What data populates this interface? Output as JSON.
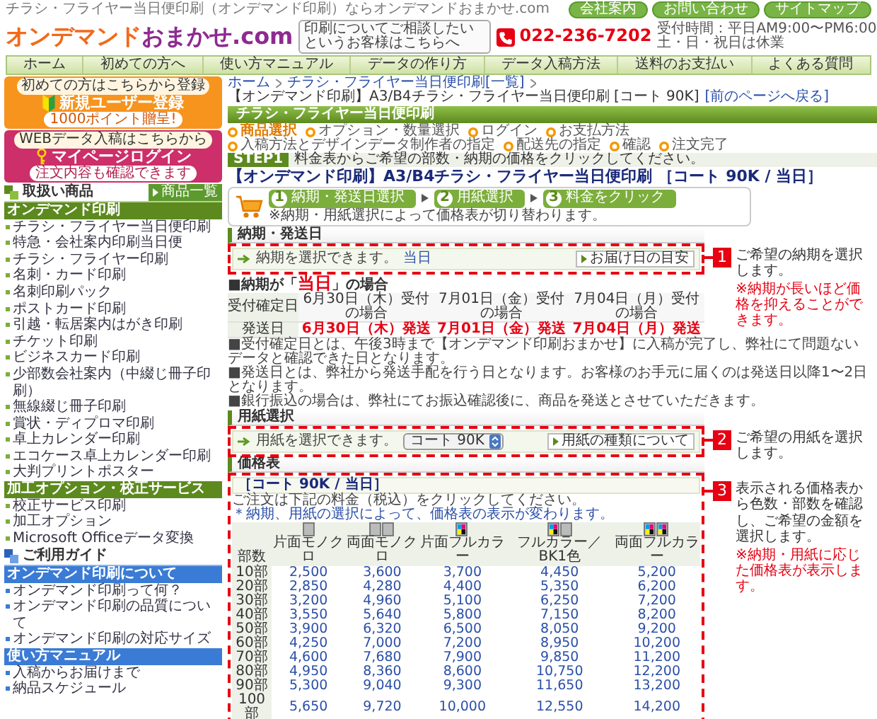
{
  "header": {
    "tagline": "チラシ・フライヤー当日便印刷（オンデマンド印刷）ならオンデマンドおまかせ.com",
    "links": [
      "会社案内",
      "お問い合わせ",
      "サイトマップ"
    ],
    "logo": {
      "part_1": "オンデマンド",
      "part_2": "おまかせ.com"
    },
    "consult_text": "印刷についてご相談したいというお客様はこちらへ",
    "phone": "022-236-7202",
    "hours": [
      "受付時間：平日AM9:00〜PM6:00",
      "土・日・祝日は休業"
    ],
    "nav": [
      "ホーム",
      "初めての方へ",
      "使い方マニュアル",
      "データの作り方",
      "データ入稿方法",
      "送料のお支払い",
      "よくある質問"
    ]
  },
  "sidebar": {
    "banners": [
      {
        "kind": "register",
        "lead": "初めての方はこちらから登録",
        "title": "新規ユーザー登録",
        "note": "1000ポイント贈呈!"
      },
      {
        "kind": "login",
        "lead": "WEBデータ入稿はこちらから",
        "title": "マイページログイン",
        "note": "注文内容も確認できます"
      }
    ],
    "products_title": "取扱い商品",
    "products_button": "商品一覧",
    "product_sections": [
      {
        "title": "オンデマンド印刷",
        "items": [
          "チラシ・フライヤー当日便印刷",
          "特急・会社案内印刷当日便",
          "チラシ・フライヤー印刷",
          "名刺・カード印刷",
          "名刺印刷パック",
          "ポストカード印刷",
          "引越・転居案内はがき印刷",
          "チケット印刷",
          "ビジネスカード印刷",
          "少部数会社案内（中綴じ冊子印刷）",
          "無線綴じ冊子印刷",
          "賞状・ディプロマ印刷",
          "卓上カレンダー印刷",
          "エコケース卓上カレンダー印刷",
          "大判プリントポスター"
        ]
      },
      {
        "title": "加工オプション・校正サービス",
        "items": [
          "校正サービス印刷",
          "加工オプション",
          "Microsoft Officeデータ変換"
        ]
      }
    ],
    "guide_title": "ご利用ガイド",
    "guide_sections": [
      {
        "title": "オンデマンド印刷について",
        "items": [
          "オンデマンド印刷って何？",
          "オンデマンド印刷の品質について",
          "オンデマンド印刷の対応サイズ"
        ]
      },
      {
        "title": "使い方マニュアル",
        "items": [
          "入稿からお届けまで",
          "納品スケジュール"
        ]
      }
    ]
  },
  "main": {
    "breadcrumb": [
      "ホーム",
      "チラシ・フライヤー当日便印刷[一覧]",
      "【オンデマンド印刷】A3/B4チラシ・フライヤー当日便印刷 [コート 90K]"
    ],
    "back_link": "[前のページへ戻る]",
    "section_bar": "チラシ・フライヤー当日便印刷",
    "order_steps": [
      {
        "label": "商品選択",
        "selected": true
      },
      {
        "label": "オプション・数量選択",
        "selected": false
      },
      {
        "label": "ログイン",
        "selected": false
      },
      {
        "label": "お支払方法",
        "selected": false
      },
      {
        "label": "入稿方法とデザインデータ制作者の指定",
        "selected": false
      },
      {
        "label": "配送先の指定",
        "selected": false
      },
      {
        "label": "確認",
        "selected": false
      },
      {
        "label": "注文完了",
        "selected": false
      }
    ],
    "step_badge": "STEP1",
    "step_text": "料金表からご希望の部数・納期の価格をクリックしてください。",
    "title_lines": [
      "【オンデマンド印刷】A3/B4チラシ・フライヤー当日便印刷",
      "［コート 90K / 当日］"
    ],
    "guide": {
      "steps": [
        {
          "number": "1",
          "label": "納期・発送日選択"
        },
        {
          "number": "2",
          "label": "用紙選択"
        },
        {
          "number": "3",
          "label": "料金をクリック"
        }
      ],
      "note": "※納期・用紙選択によって価格表が切り替わります。"
    },
    "delivery": {
      "heading": "納期・発送日",
      "prompt": "納期を選択できます。",
      "value": "当日",
      "button": "お届け日の目安"
    },
    "same_day": {
      "prefix": "■納期が「",
      "highlight": "当日",
      "suffix": "」の場合",
      "rows": [
        {
          "kind": "accept",
          "label": "受付確定日",
          "cells": [
            "6月30日（木）受付の場合",
            "7月01日（金）受付の場合",
            "7月04日（月）受付の場合"
          ]
        },
        {
          "kind": "ship",
          "label": "発送日",
          "cells": [
            "6月30日（木）発送",
            "7月01日（金）発送",
            "7月04日（月）発送"
          ]
        }
      ],
      "notes": [
        "■受付確定日とは、午後3時まで【オンデマンド印刷おまかせ】に入稿が完了し、弊社にて問題ないデータと確認できた日となります。",
        "■発送日とは、弊社から発送手配を行う日となります。お客様のお手元に届くのは発送日以降1〜2日となります。",
        "■銀行振込の場合は、弊社にてお振込確認後に、商品を発送とさせていただきます。"
      ]
    },
    "paper": {
      "heading": "用紙選択",
      "prompt": "用紙を選択できます。",
      "value": "コート 90K",
      "button": "用紙の種類について"
    },
    "price": {
      "heading": "価格表",
      "table_title": "［コート 90K / 当日］",
      "note": "ご注文は下記の料金（税込）をクリックしてください。",
      "note_2": "＊納期、用紙の選択によって、価格表の表示が変わります。",
      "columns": [
        {
          "label": "部数",
          "kind": "label"
        },
        {
          "label": "片面モノクロ",
          "kind": "mono_single"
        },
        {
          "label": "両面モノクロ",
          "kind": "mono_double"
        },
        {
          "label": "片面フルカラー",
          "kind": "color_single"
        },
        {
          "label": "フルカラー／BK1色",
          "kind": "color_bk"
        },
        {
          "label": "両面フルカラー",
          "kind": "color_double"
        }
      ],
      "rows": [
        {
          "qty": "10部",
          "prices": [
            "2,500",
            "3,600",
            "3,700",
            "4,450",
            "5,200"
          ]
        },
        {
          "qty": "20部",
          "prices": [
            "2,850",
            "4,280",
            "4,400",
            "5,350",
            "6,200"
          ]
        },
        {
          "qty": "30部",
          "prices": [
            "3,200",
            "4,960",
            "5,100",
            "6,250",
            "7,200"
          ]
        },
        {
          "qty": "40部",
          "prices": [
            "3,550",
            "5,640",
            "5,800",
            "7,150",
            "8,200"
          ]
        },
        {
          "qty": "50部",
          "prices": [
            "3,900",
            "6,320",
            "6,500",
            "8,050",
            "9,200"
          ]
        },
        {
          "qty": "60部",
          "prices": [
            "4,250",
            "7,000",
            "7,200",
            "8,950",
            "10,200"
          ]
        },
        {
          "qty": "70部",
          "prices": [
            "4,600",
            "7,680",
            "7,900",
            "9,850",
            "11,200"
          ]
        },
        {
          "qty": "80部",
          "prices": [
            "4,950",
            "8,360",
            "8,600",
            "10,750",
            "12,200"
          ]
        },
        {
          "qty": "90部",
          "prices": [
            "5,300",
            "9,040",
            "9,300",
            "11,650",
            "13,200"
          ]
        },
        {
          "qty": "100部",
          "prices": [
            "5,650",
            "9,720",
            "10,000",
            "12,550",
            "14,200"
          ]
        }
      ]
    }
  },
  "callouts": [
    {
      "number": "1",
      "text": "ご希望の納期を選択します。",
      "note": "※納期が長いほど価格を抑えることができます。"
    },
    {
      "number": "2",
      "text": "ご希望の用紙を選択します。"
    },
    {
      "number": "3",
      "text": "表示される価格表から色数・部数を確認し、ご希望の金額を選択します。",
      "note": "※納期・用紙に応じた価格表が表示します。"
    }
  ]
}
